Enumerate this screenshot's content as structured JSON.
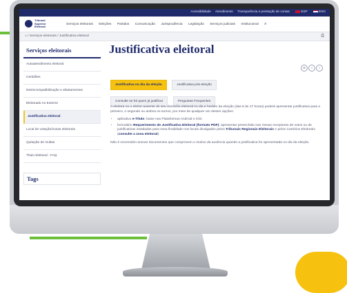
{
  "colors": {
    "accent_green": "#6bbf3a",
    "accent_yellow": "#f6c20f",
    "brand_navy": "#1f2a6b"
  },
  "topbar": {
    "links": [
      "Acessibilidade",
      "Atendimento",
      "Transparência e prestação de contas"
    ],
    "lang_es": "ESP",
    "lang_en": "ENG"
  },
  "logo": {
    "line1": "Tribunal",
    "line2": "Superior",
    "line3": "Eleitoral"
  },
  "menu": {
    "items": [
      "Serviços eleitorais",
      "Eleições",
      "Partidos",
      "Comunicação",
      "Jurisprudência",
      "Legislação",
      "Serviços judiciais",
      "Institucional"
    ],
    "search_icon": "search-icon"
  },
  "breadcrumb": {
    "home_icon": "home-icon",
    "text": "/ Serviços eleitorais / Justificativa eleitoral"
  },
  "print_icon": "print-icon",
  "sidebar": {
    "title": "Serviços eleitorais",
    "items": [
      "Autoatendimento eleitoral",
      "Certidões",
      "Desincompatibilização e afastamentos",
      "Eleitorado no Exterior",
      "Justificativa eleitoral",
      "Local de votação/zonas eleitorais",
      "Quitação de multas",
      "Título Eleitoral - FAQ"
    ],
    "active_index": 4,
    "tags_title": "Tags"
  },
  "main": {
    "title": "Justificativa eleitoral",
    "share": [
      "email-icon",
      "facebook-icon",
      "twitter-icon"
    ],
    "tabs": [
      "Justificativa no dia da eleição",
      "Justificativa pós-eleição",
      "Consulte se há quem já justificar",
      "Perguntas Frequentes"
    ],
    "active_tab": 0,
    "intro": "A eleitora ou o eleitor ausente do seu domicílio eleitoral no dia e horário da eleição (das 8 às 17 horas) poderá apresentar justificativa para o primeiro, o segundo ou ambos os turnos, por meio de qualquer um destes opções:",
    "bullet1_prefix": "aplicativo ",
    "bullet1_bold": "e-Título",
    "bullet1_suffix": ": baixe nas Plataformas Android e iOS;",
    "bullet2_prefix": "formulário ",
    "bullet2_bold": "Requerimento de Justificativa Eleitoral (formato PDF)",
    "bullet2_mid": ": apresentar preenchido nas mesas receptoras de votos ou de justificativas instaladas para essa finalidade nos locais divulgados pelos ",
    "bullet2_bold2": "Tribunais Regionais Eleitorais",
    "bullet2_mid2": " e pelos Cartórios Eleitorais (",
    "bullet2_bold3": "consulte a zona eleitoral",
    "bullet2_end": ").",
    "note": "Não é necessário anexar documentos que comprovem o motivo da ausência quando a justificativa for apresentada no dia da eleição."
  }
}
